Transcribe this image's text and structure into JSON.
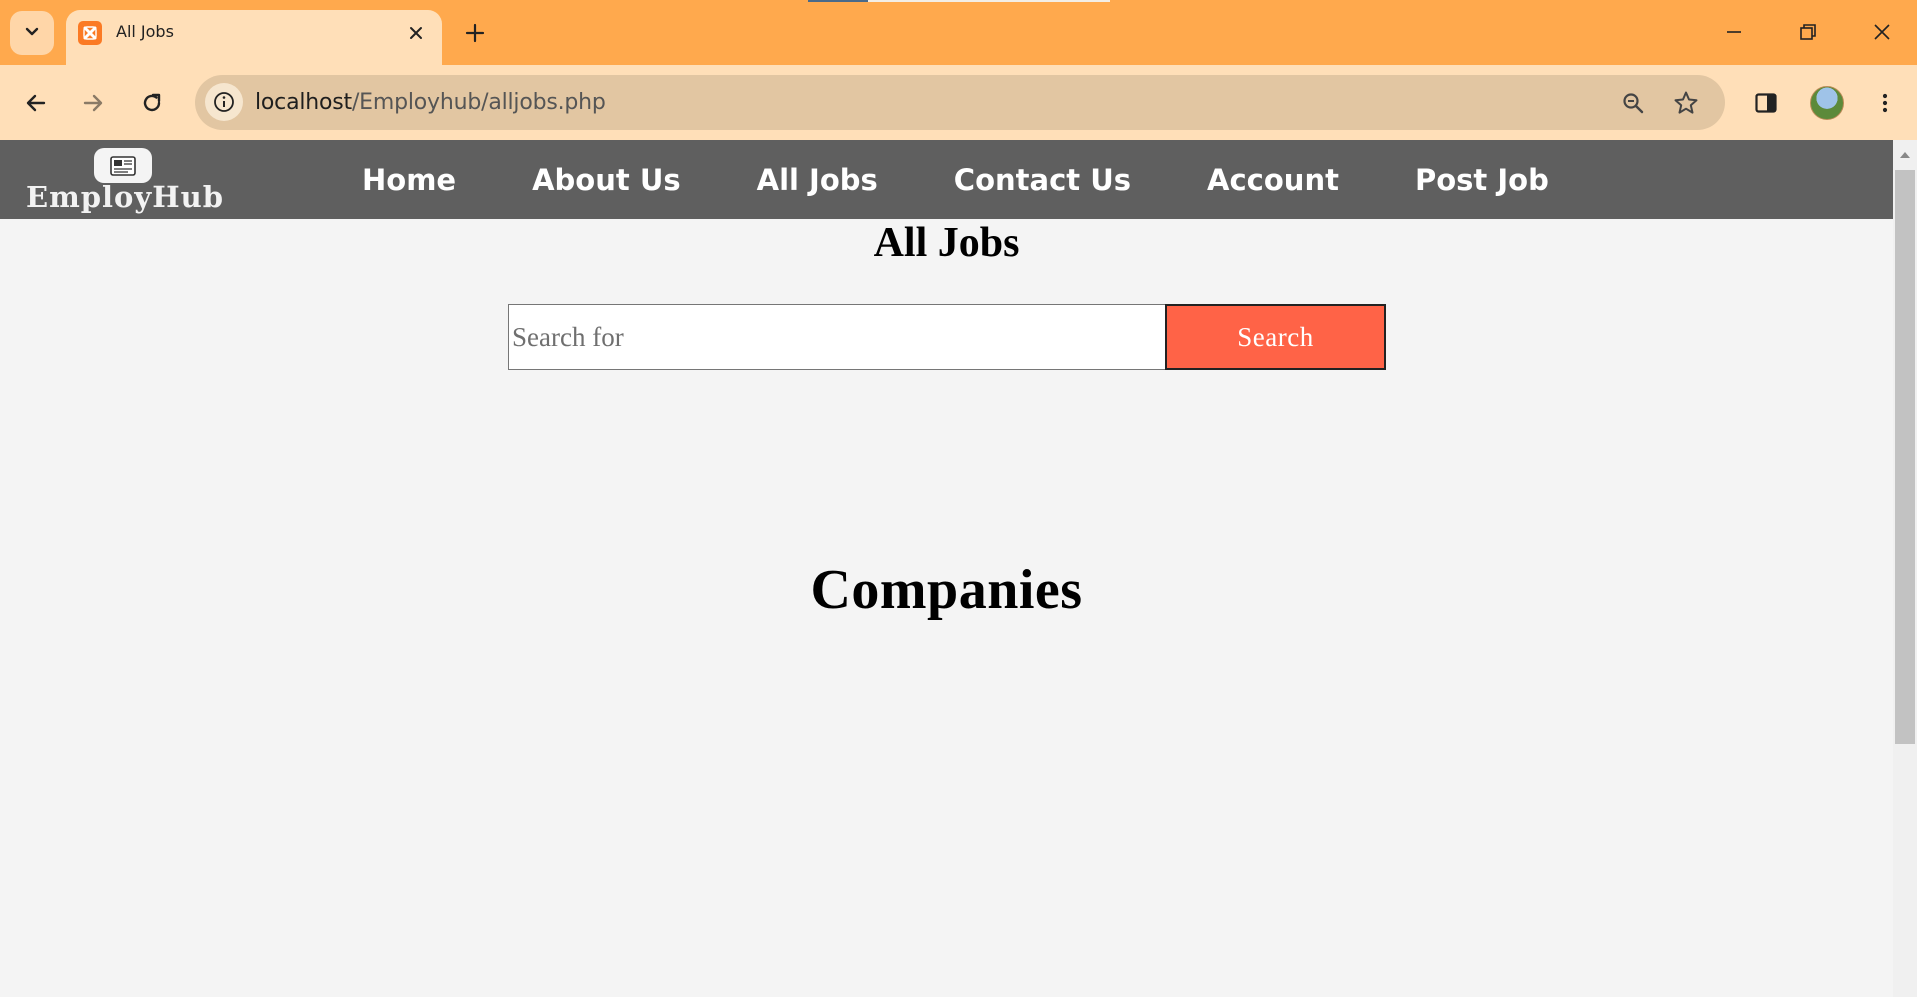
{
  "browser": {
    "tab_title": "All Jobs",
    "url_host": "localhost",
    "url_path": "/Employhub/alljobs.php",
    "accent_color": "#ffa94d",
    "icons": [
      "tab-search-icon",
      "xampp-favicon-icon",
      "close-icon",
      "plus-icon",
      "minimize-icon",
      "restore-icon",
      "window-close-icon",
      "back-icon",
      "forward-icon",
      "reload-icon",
      "info-icon",
      "zoom-icon",
      "star-icon",
      "side-panel-icon",
      "kebab-menu-icon"
    ]
  },
  "site": {
    "logo_text": "EmployHub",
    "nav_items": [
      "Home",
      "About Us",
      "All Jobs",
      "Contact Us",
      "Account",
      "Post Job"
    ],
    "nav_bg": "#5f5f5f"
  },
  "main": {
    "title": "All Jobs",
    "search": {
      "placeholder": "Search for",
      "button_label": "Search",
      "button_color": "#ff6347"
    },
    "companies_heading": "Companies"
  }
}
